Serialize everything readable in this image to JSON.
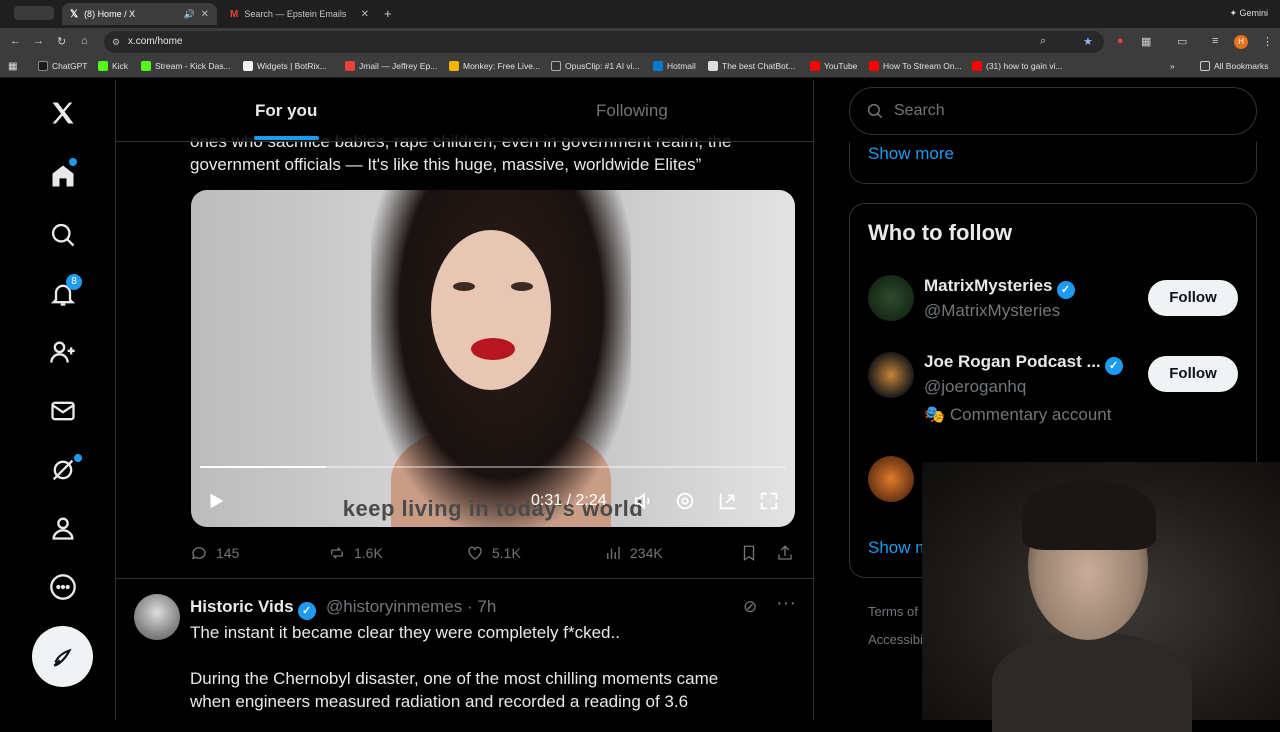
{
  "browser": {
    "tabs": [
      {
        "label": "(8) Home / X",
        "icon": "x-logo-icon",
        "active": true
      },
      {
        "label": "Search — Epstein Emails",
        "icon": "gmail-icon",
        "active": false
      }
    ],
    "profile_label": "Gemini",
    "url": "x.com/home",
    "bookmarks": [
      {
        "label": "ChatGPT",
        "color": "#1a1a1a"
      },
      {
        "label": "Kick",
        "color": "#53fc18"
      },
      {
        "label": "Stream - Kick Das...",
        "color": "#53fc18"
      },
      {
        "label": "Widgets | BotRix...",
        "color": "#f2f2f2"
      },
      {
        "label": "Jmail — Jeffrey Ep...",
        "color": "#ea4335"
      },
      {
        "label": "Monkey: Free Live...",
        "color": "#f4b400"
      },
      {
        "label": "OpusClip: #1 AI vi...",
        "color": "#333333"
      },
      {
        "label": "Hotmail",
        "color": "#0078d4"
      },
      {
        "label": "The best ChatBot...",
        "color": "#dddddd"
      },
      {
        "label": "YouTube",
        "color": "#ff0000"
      },
      {
        "label": "How To Stream On...",
        "color": "#ff0000"
      },
      {
        "label": "(31) how to gain vi...",
        "color": "#ff0000"
      }
    ],
    "all_bookmarks": "All Bookmarks"
  },
  "nav": {
    "notifications_badge": "8"
  },
  "feed": {
    "tabs": [
      "For you",
      "Following"
    ],
    "tweet1": {
      "text_line1": "ones who sacrifice babies, rape children, even in government realm, the",
      "text_line2": "government officials — It's like this huge, massive, worldwide Elites”",
      "video": {
        "subtitle": "keep living in today's world",
        "time": "0:31 / 2:24",
        "progress": 0.215
      },
      "replies": "145",
      "reposts": "1.6K",
      "likes": "5.1K",
      "views": "234K"
    },
    "tweet2": {
      "name": "Historic Vids",
      "handle": "@historyinmemes · 7h",
      "line1": "The instant it became clear they were completely f*cked..",
      "line2": "During the Chernobyl disaster, one of the most chilling moments came",
      "line3": "when engineers measured radiation and recorded a reading of 3.6"
    }
  },
  "sidebar": {
    "search_placeholder": "Search",
    "show_more": "Show more",
    "who_to_follow": "Who to follow",
    "accounts": [
      {
        "name": "MatrixMysteries",
        "handle": "@MatrixMysteries",
        "follow": "Follow"
      },
      {
        "name": "Joe Rogan Podcast ...",
        "handle": "@joeroganhq",
        "note": "Commentary account",
        "follow": "Follow"
      }
    ],
    "show_more_partial": "Show m",
    "footer_terms": "Terms of",
    "footer_access": "Accessibi"
  }
}
